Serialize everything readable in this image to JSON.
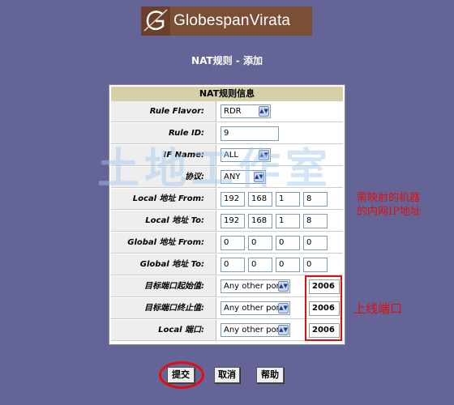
{
  "logo": {
    "text": "GlobespanVirata"
  },
  "page": {
    "title": "NAT规则 - 添加"
  },
  "watermark": "土地工作室",
  "form": {
    "header": "NAT规则信息",
    "rule_flavor": {
      "label": "Rule Flavor:",
      "value": "RDR"
    },
    "rule_id": {
      "label": "Rule ID:",
      "value": "9"
    },
    "if_name": {
      "label": "IF Name:",
      "value": "ALL"
    },
    "protocol": {
      "label": "协议:",
      "value": "ANY"
    },
    "local_from": {
      "label": "Local 地址 From:",
      "ip": [
        "192",
        "168",
        "1",
        "8"
      ]
    },
    "local_to": {
      "label": "Local 地址 To:",
      "ip": [
        "192",
        "168",
        "1",
        "8"
      ]
    },
    "global_from": {
      "label": "Global 地址 From:",
      "ip": [
        "0",
        "0",
        "0",
        "0"
      ]
    },
    "global_to": {
      "label": "Global 地址 To:",
      "ip": [
        "0",
        "0",
        "0",
        "0"
      ]
    },
    "dest_port_start": {
      "label": "目标端口起始值:",
      "select": "Any other port",
      "value": "2006"
    },
    "dest_port_end": {
      "label": "目标端口终止值:",
      "select": "Any other port",
      "value": "2006"
    },
    "local_port": {
      "label": "Local 端口:",
      "select": "Any other port",
      "value": "2006"
    }
  },
  "annotations": {
    "ip_note_line1": "需映射的机器",
    "ip_note_line2": "的内网IP地址",
    "port_note": "上线端口"
  },
  "buttons": {
    "submit": "提交",
    "cancel": "取消",
    "help": "帮助"
  },
  "colors": {
    "background": "#646496",
    "logo_bg": "#7b4e36",
    "header_bg": "#d6d0a8",
    "annotation": "#e01010"
  }
}
